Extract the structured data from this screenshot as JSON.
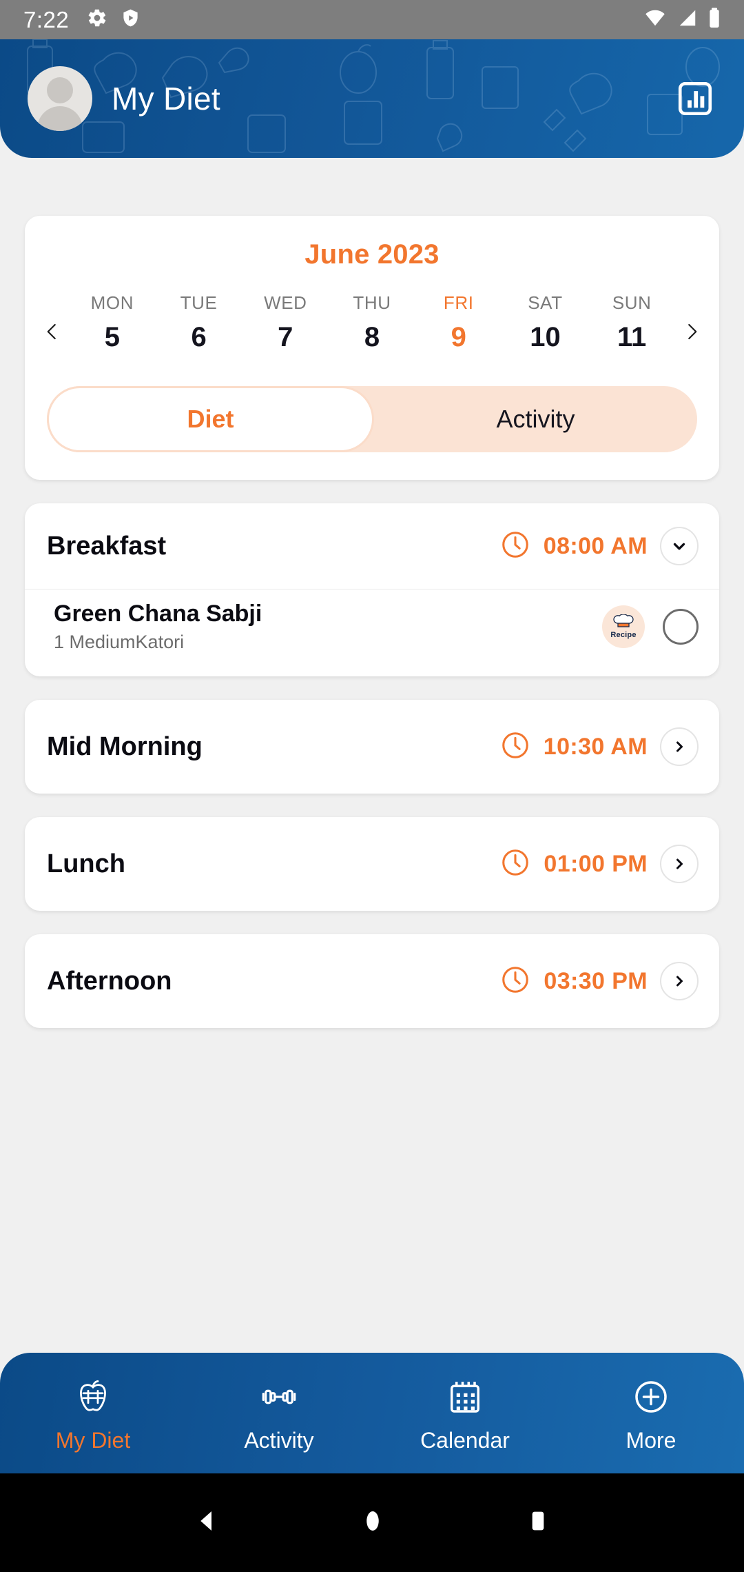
{
  "status_bar": {
    "time": "7:22",
    "left_icons": [
      "settings-icon",
      "play-protect-icon"
    ],
    "right_icons": [
      "wifi-icon",
      "signal-icon",
      "battery-icon"
    ]
  },
  "header": {
    "title": "My Diet",
    "avatar": "user-avatar",
    "chart_icon": "bar-chart-icon",
    "bg_color": "#11559a"
  },
  "calendar": {
    "month": "June 2023",
    "prev_icon": "chevron-left-icon",
    "next_icon": "chevron-right-icon",
    "days": [
      {
        "dow": "MON",
        "num": "5",
        "active": false
      },
      {
        "dow": "TUE",
        "num": "6",
        "active": false
      },
      {
        "dow": "WED",
        "num": "7",
        "active": false
      },
      {
        "dow": "THU",
        "num": "8",
        "active": false
      },
      {
        "dow": "FRI",
        "num": "9",
        "active": true
      },
      {
        "dow": "SAT",
        "num": "10",
        "active": false
      },
      {
        "dow": "SUN",
        "num": "11",
        "active": false
      }
    ]
  },
  "toggle": {
    "diet_label": "Diet",
    "activity_label": "Activity",
    "selected": "Diet",
    "accent": "#f2762e",
    "track_color": "#fbe3d4"
  },
  "meals": [
    {
      "name": "Breakfast",
      "time": "08:00 AM",
      "clock_icon": "clock-icon",
      "action_icon": "chevron-down-icon",
      "expanded": true,
      "items": [
        {
          "name": "Green Chana Sabji",
          "quantity": "1 MediumKatori",
          "recipe_label": "Recipe",
          "recipe_icon": "chef-hat-icon",
          "checked": false
        }
      ]
    },
    {
      "name": "Mid Morning",
      "time": "10:30 AM",
      "clock_icon": "clock-icon",
      "action_icon": "chevron-right-icon",
      "expanded": false,
      "items": []
    },
    {
      "name": "Lunch",
      "time": "01:00 PM",
      "clock_icon": "clock-icon",
      "action_icon": "chevron-right-icon",
      "expanded": false,
      "items": []
    },
    {
      "name": "Afternoon",
      "time": "03:30 PM",
      "clock_icon": "clock-icon",
      "action_icon": "chevron-right-icon",
      "expanded": false,
      "items": []
    }
  ],
  "bottom_nav": {
    "items": [
      {
        "label": "My Diet",
        "icon": "apple-measure-icon",
        "active": true
      },
      {
        "label": "Activity",
        "icon": "dumbbell-icon",
        "active": false
      },
      {
        "label": "Calendar",
        "icon": "calendar-icon",
        "active": false
      },
      {
        "label": "More",
        "icon": "plus-circle-icon",
        "active": false
      }
    ],
    "active_color": "#f2762e"
  },
  "system_nav": {
    "back": "back-triangle-icon",
    "home": "home-circle-icon",
    "recents": "recents-square-icon"
  }
}
